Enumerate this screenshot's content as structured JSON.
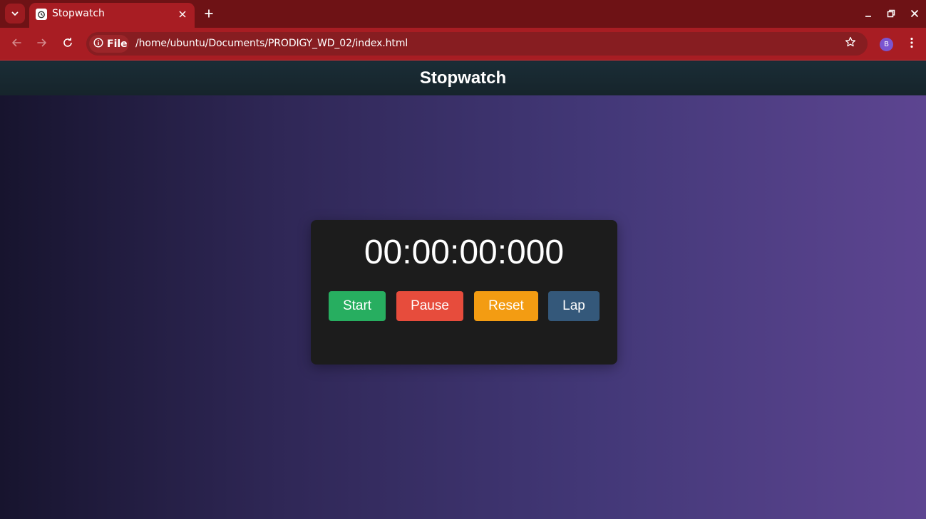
{
  "browser": {
    "tab": {
      "title": "Stopwatch"
    },
    "omnibox": {
      "chip_label": "File",
      "url": "/home/ubuntu/Documents/PRODIGY_WD_02/index.html"
    },
    "profile_initial": "B",
    "colors": {
      "tabstrip": "#6e1215",
      "toolbar": "#a81d23",
      "omnibox": "#871d21"
    }
  },
  "page": {
    "header": {
      "title": "Stopwatch"
    },
    "stopwatch": {
      "time": "00:00:00:000",
      "buttons": [
        {
          "label": "Start",
          "color": "#27ae60"
        },
        {
          "label": "Pause",
          "color": "#e74c3c"
        },
        {
          "label": "Reset",
          "color": "#f39c12"
        },
        {
          "label": "Lap",
          "color": "#34587a"
        }
      ]
    }
  }
}
